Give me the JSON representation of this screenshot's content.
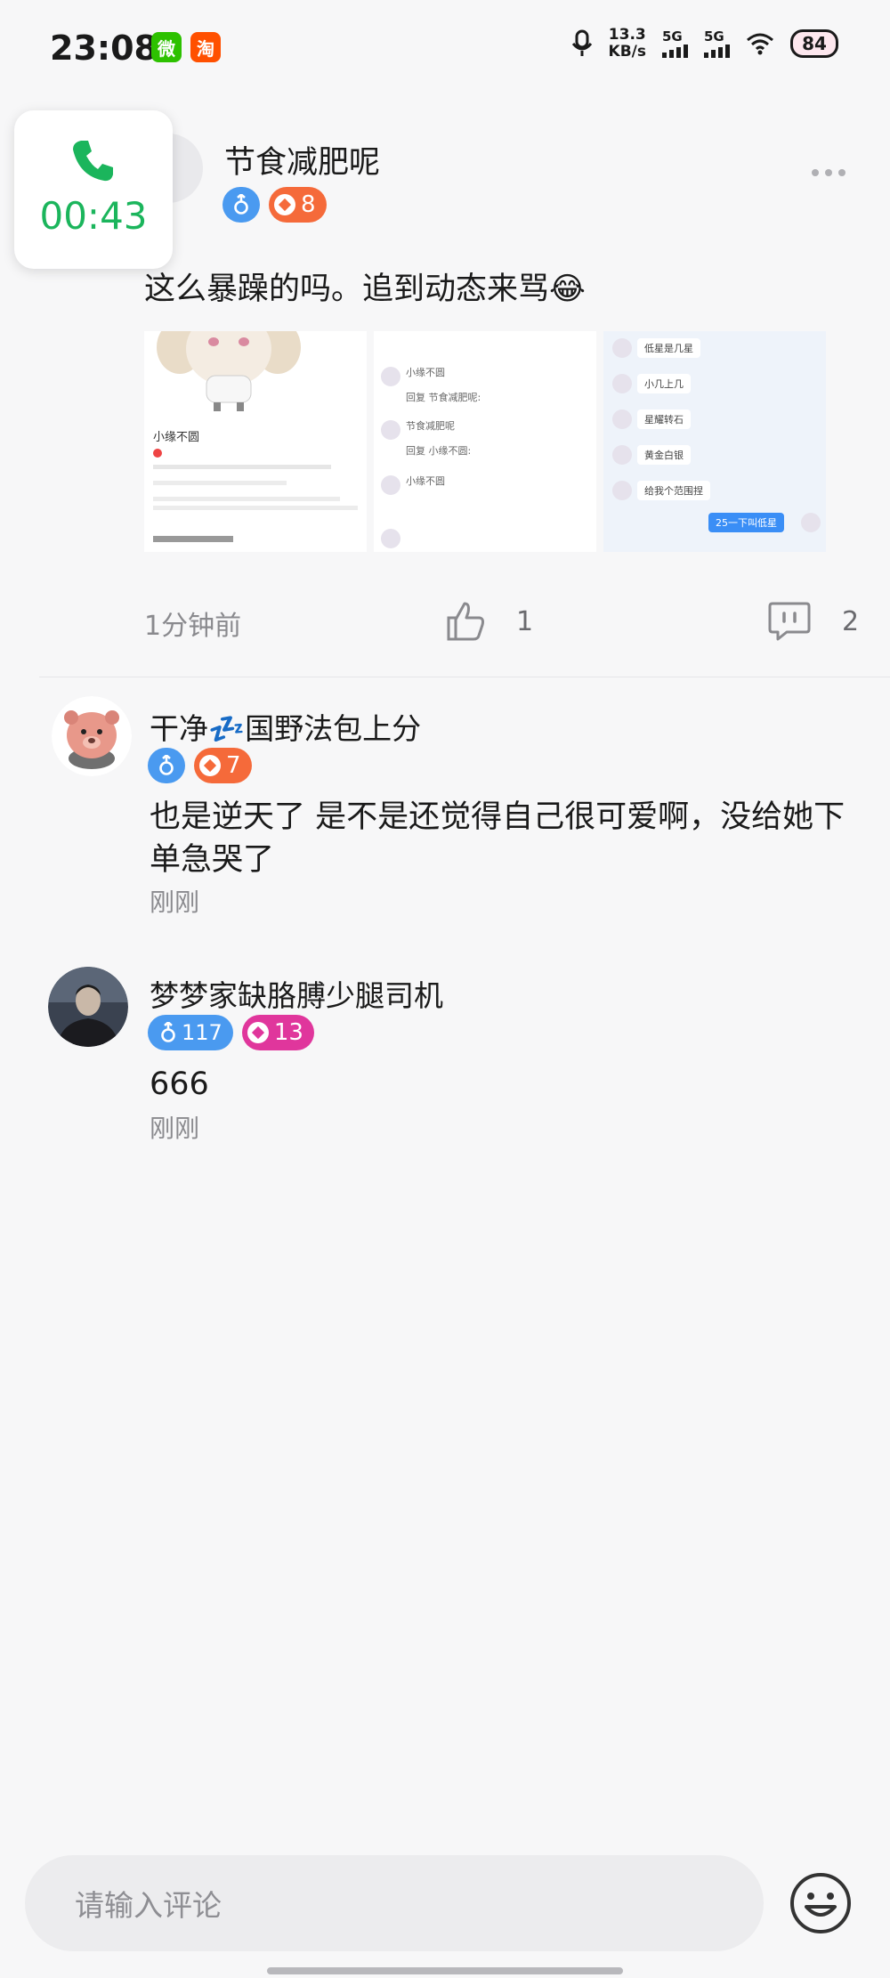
{
  "status_bar": {
    "time": "23:08",
    "apps": [
      {
        "name": "wechat-icon",
        "glyph": "微",
        "color": "#2dc100"
      },
      {
        "name": "taobao-icon",
        "glyph": "淘",
        "color": "#ff5000"
      }
    ],
    "net_speed_value": "13.3",
    "net_speed_unit": "KB/s",
    "sim1_label": "5G",
    "sim2_label": "5G",
    "battery": "84"
  },
  "call_widget": {
    "duration": "00:43",
    "color": "#1bb55c"
  },
  "post": {
    "username": "节食减肥呢",
    "level": "8",
    "text": "这么暴躁的吗。追到动态来骂😂",
    "images": {
      "shot1": {
        "name": "小缘不圆"
      },
      "shot2": {
        "lines": [
          "小缘不圆",
          "回复 节食减肥呢:",
          "节食减肥呢",
          "回复 小缘不圆:",
          "小缘不圆"
        ]
      },
      "shot3": {
        "bubbles": [
          "低星是几星",
          "小几上几",
          "星耀转石",
          "黄金白银",
          "给我个范围捏"
        ],
        "reply": "25一下叫低星"
      }
    },
    "timestamp": "1分钟前",
    "likes": "1",
    "comments": "2"
  },
  "comments": [
    {
      "username": "干净💤国野法包上分",
      "level": "7",
      "level_color": "orange",
      "text": "也是逆天了 是不是还觉得自己很可爱啊，没给她下单急哭了",
      "time": "刚刚"
    },
    {
      "username": "梦梦家缺胳膊少腿司机",
      "gender_count": "117",
      "level": "13",
      "level_color": "pink",
      "text": "666",
      "time": "刚刚"
    }
  ],
  "input": {
    "placeholder": "请输入评论"
  },
  "colors": {
    "accent_green": "#1bb55c",
    "gender_blue": "#4a9af0",
    "level_orange": "#f56a3a",
    "level_pink": "#e0369c"
  }
}
